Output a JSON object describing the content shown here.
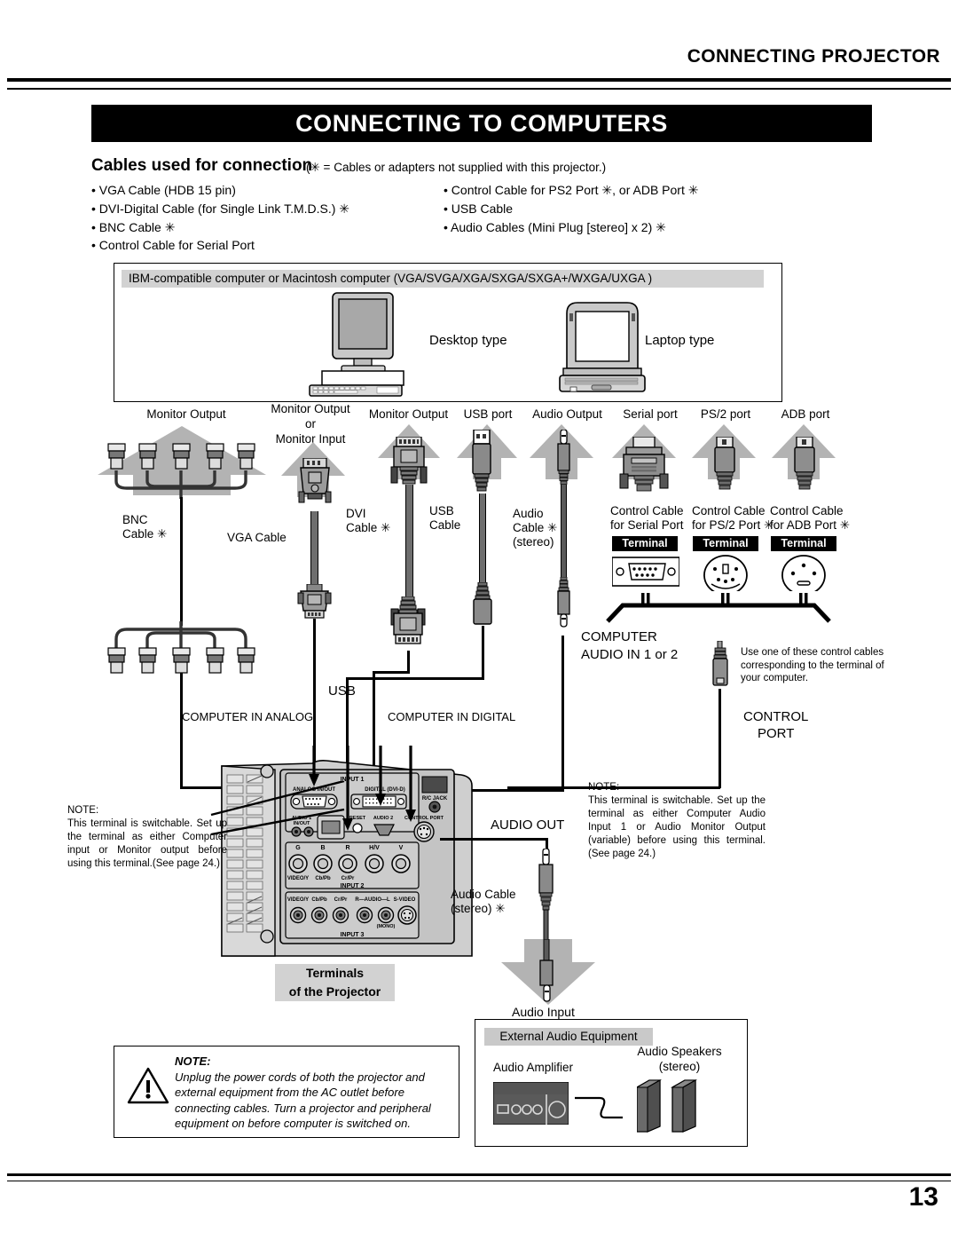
{
  "header": {
    "running_head": "CONNECTING PROJECTOR",
    "title": "CONNECTING TO COMPUTERS"
  },
  "cables_section": {
    "heading": "Cables used for connection",
    "note": "(✳ = Cables or adapters not supplied with this projector.)",
    "left_items": [
      "• VGA Cable (HDB 15 pin)",
      "• DVI-Digital Cable (for Single Link T.M.D.S.) ✳",
      "• BNC Cable ✳",
      "• Control Cable for Serial Port"
    ],
    "right_items": [
      "• Control Cable for PS2 Port ✳, or ADB Port ✳",
      "• USB Cable",
      "• Audio Cables (Mini Plug [stereo] x 2) ✳"
    ]
  },
  "computer_box": {
    "title": "IBM-compatible computer or Macintosh computer (VGA/SVGA/XGA/SXGA/SXGA+/WXGA/UXGA )",
    "desktop_label": "Desktop type",
    "laptop_label": "Laptop type"
  },
  "port_labels": {
    "bnc_monitor_output": "Monitor Output",
    "vga_monitor_output_line1": "Monitor Output",
    "vga_monitor_output_line2": "or",
    "vga_monitor_output_line3": "Monitor Input",
    "dvi_monitor_output": "Monitor Output",
    "usb_port": "USB port",
    "audio_output": "Audio Output",
    "serial_port": "Serial port",
    "ps2_port": "PS/2 port",
    "adb_port": "ADB port"
  },
  "cable_captions": {
    "bnc_line1": "BNC",
    "bnc_line2": "Cable ✳",
    "vga": "VGA Cable",
    "dvi_line1": "DVI",
    "dvi_line2": "Cable ✳",
    "usb_line1": "USB",
    "usb_line2": "Cable",
    "audio_line1": "Audio",
    "audio_line2": "Cable ✳",
    "audio_line3": "(stereo)",
    "serial_line1": "Control Cable",
    "serial_line2": "for Serial Port",
    "ps2_line1": "Control Cable",
    "ps2_line2": "for PS/2 Port ✳",
    "adb_line1": "Control Cable",
    "adb_line2": "for ADB Port ✳",
    "terminal_badge": "Terminal"
  },
  "diagram_labels": {
    "computer_audio_in_line1": "COMPUTER",
    "computer_audio_in_line2": "AUDIO IN 1 or 2",
    "usb": "USB",
    "computer_in_analog": "COMPUTER IN ANALOG",
    "computer_in_digital": "COMPUTER IN DIGITAL",
    "control_port_line1": "CONTROL",
    "control_port_line2": "PORT",
    "audio_out": "AUDIO OUT",
    "audio_cable_line1": "Audio Cable",
    "audio_cable_line2": "(stereo) ✳",
    "audio_input": "Audio Input",
    "control_tip": "Use one of these control cables corresponding to the terminal of your computer.",
    "terminals_line1": "Terminals",
    "terminals_line2": "of the Projector"
  },
  "projector_panel": {
    "input1": "INPUT 1",
    "analog_in": "ANALOG IN/OUT",
    "digital_dvi": "DIGITAL (DVI-D)",
    "rc_jack": "R/C JACK",
    "audio1": "AUDIO 1 IN/OUT",
    "reset": "RESET",
    "audio2": "AUDIO 2",
    "control_port": "CONTROL PORT",
    "bnc_labels": [
      "G",
      "B",
      "R",
      "H/V",
      "V"
    ],
    "input2_rca": [
      "VIDEO/Y",
      "Cb/Pb",
      "Cr/Pr"
    ],
    "input2": "INPUT 2",
    "input3_labels": [
      "VIDEO/Y",
      "Cb/Pb",
      "Cr/Pr",
      "R—AUDIO—L",
      "S-VIDEO"
    ],
    "mono": "(MONO)",
    "input3": "INPUT 3"
  },
  "notes": {
    "left_title": "NOTE:",
    "left_body": "This terminal is switchable. Set up the terminal as either Computer input or Monitor output before using this terminal.(See page 24.)",
    "right_title": "NOTE:",
    "right_body": "This terminal is switchable. Set up the terminal as either Computer Audio Input 1 or Audio Monitor Output (variable) before using this terminal. (See page 24.)",
    "bottom_title": "NOTE:",
    "bottom_body": "Unplug the power cords of both the projector and external equipment from the AC outlet before connecting cables. Turn a projector and peripheral equipment on before computer is switched on."
  },
  "external_audio": {
    "box_title": "External Audio Equipment",
    "amplifier": "Audio Amplifier",
    "speakers_line1": "Audio Speakers",
    "speakers_line2": "(stereo)"
  },
  "footer": {
    "page_number": "13"
  },
  "colors": {
    "gray_arrow": "#b3b3b3",
    "gray_panel": "#d2d2d2",
    "dark_gray": "#808080",
    "connector_gray": "#8c8c8c",
    "black": "#000000"
  }
}
